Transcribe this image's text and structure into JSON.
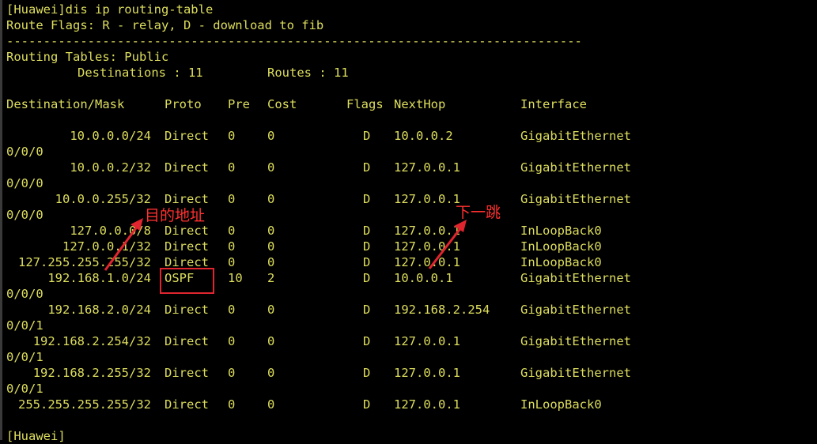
{
  "terminal": {
    "command_line": "[Huawei]dis ip routing-table",
    "flags_line": "Route Flags: R - relay, D - download to fib",
    "separator": "------------------------------------------------------------------------------",
    "tables_line": "Routing Tables: Public",
    "destinations_label": "Destinations : 11",
    "routes_label": "Routes : 11",
    "headers": {
      "dest": "Destination/Mask",
      "proto": "Proto",
      "pre": "Pre",
      "cost": "Cost",
      "flags": "Flags",
      "nexthop": "NextHop",
      "iface": "Interface"
    },
    "routes": [
      {
        "dest": "10.0.0.0/24",
        "proto": "Direct",
        "pre": "0",
        "cost": "0",
        "flags": "D",
        "nexthop": "10.0.0.2",
        "iface": "GigabitEthernet",
        "iface_cont": "0/0/0"
      },
      {
        "dest": "10.0.0.2/32",
        "proto": "Direct",
        "pre": "0",
        "cost": "0",
        "flags": "D",
        "nexthop": "127.0.0.1",
        "iface": "GigabitEthernet",
        "iface_cont": "0/0/0"
      },
      {
        "dest": "10.0.0.255/32",
        "proto": "Direct",
        "pre": "0",
        "cost": "0",
        "flags": "D",
        "nexthop": "127.0.0.1",
        "iface": "GigabitEthernet",
        "iface_cont": "0/0/0"
      },
      {
        "dest": "127.0.0.0/8",
        "proto": "Direct",
        "pre": "0",
        "cost": "0",
        "flags": "D",
        "nexthop": "127.0.0.1",
        "iface": "InLoopBack0",
        "iface_cont": ""
      },
      {
        "dest": "127.0.0.1/32",
        "proto": "Direct",
        "pre": "0",
        "cost": "0",
        "flags": "D",
        "nexthop": "127.0.0.1",
        "iface": "InLoopBack0",
        "iface_cont": ""
      },
      {
        "dest": "127.255.255.255/32",
        "proto": "Direct",
        "pre": "0",
        "cost": "0",
        "flags": "D",
        "nexthop": "127.0.0.1",
        "iface": "InLoopBack0",
        "iface_cont": ""
      },
      {
        "dest": "192.168.1.0/24",
        "proto": "OSPF",
        "pre": "10",
        "cost": "2",
        "flags": "D",
        "nexthop": "10.0.0.1",
        "iface": "GigabitEthernet",
        "iface_cont": "0/0/0"
      },
      {
        "dest": "192.168.2.0/24",
        "proto": "Direct",
        "pre": "0",
        "cost": "0",
        "flags": "D",
        "nexthop": "192.168.2.254",
        "iface": "GigabitEthernet",
        "iface_cont": "0/0/1"
      },
      {
        "dest": "192.168.2.254/32",
        "proto": "Direct",
        "pre": "0",
        "cost": "0",
        "flags": "D",
        "nexthop": "127.0.0.1",
        "iface": "GigabitEthernet",
        "iface_cont": "0/0/1"
      },
      {
        "dest": "192.168.2.255/32",
        "proto": "Direct",
        "pre": "0",
        "cost": "0",
        "flags": "D",
        "nexthop": "127.0.0.1",
        "iface": "GigabitEthernet",
        "iface_cont": "0/0/1"
      },
      {
        "dest": "255.255.255.255/32",
        "proto": "Direct",
        "pre": "0",
        "cost": "0",
        "flags": "D",
        "nexthop": "127.0.0.1",
        "iface": "InLoopBack0",
        "iface_cont": ""
      }
    ],
    "prompt": "[Huawei]"
  },
  "annotations": {
    "dest_label": "目的地址",
    "nexthop_label": "下一跳",
    "color": "#ff3030"
  },
  "colors": {
    "background": "#000000",
    "text": "#dede5e"
  }
}
